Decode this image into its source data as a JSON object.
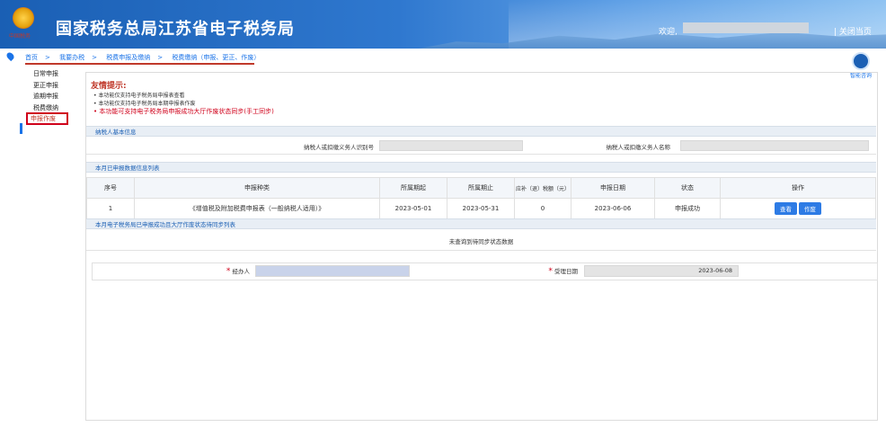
{
  "header": {
    "title": "国家税务总局江苏省电子税务局",
    "welcome": "欢迎,",
    "close_link": "| 关闭当页",
    "emblem_text": "中国税务"
  },
  "breadcrumb": [
    "首页",
    "我要办税",
    "税费申报及缴纳",
    "税费缴纳（申报、更正、作废）"
  ],
  "breadcrumb_sep": ">",
  "help_label": "智能咨询",
  "sidebar": {
    "items": [
      {
        "label": "日常申报"
      },
      {
        "label": "更正申报"
      },
      {
        "label": "逾期申报"
      },
      {
        "label": "税费缴纳"
      },
      {
        "label": "申报作废",
        "active": true
      }
    ]
  },
  "tips": {
    "title": "友情提示:",
    "items": [
      "本功能仅支持电子税务局申报表查看",
      "本功能仅支持电子税务局本期申报表作废",
      "本功能可支持电子税务局申报成功大厅作废状态同步(手工同步)"
    ]
  },
  "section_basic": "纳税人基本信息",
  "taxpayer_id_label": "纳税人或扣缴义务人识别号",
  "taxpayer_name_label": "纳税人或扣缴义务人名称",
  "section_list": "本月已申报数据信息列表",
  "table": {
    "headers": [
      "序号",
      "申报种类",
      "所属期起",
      "所属期止",
      "应补（退）税额（元）",
      "申报日期",
      "状态",
      "操作"
    ],
    "rows": [
      {
        "no": "1",
        "type": "《增值税及附加税费申报表（一般纳税人适用）》",
        "start": "2023-05-01",
        "end": "2023-05-31",
        "amount": "0",
        "date": "2023-06-06",
        "status": "申报成功",
        "view": "查看",
        "void": "作废"
      }
    ]
  },
  "section_sync": "本月电子税务局已申报成功且大厅作废状态待同步列表",
  "no_data": "未查询到待同步状态数据",
  "form": {
    "agent_label": "经办人",
    "accept_date_label": "受理日期",
    "accept_date": "2023-06-08",
    "required_mark": "*"
  }
}
